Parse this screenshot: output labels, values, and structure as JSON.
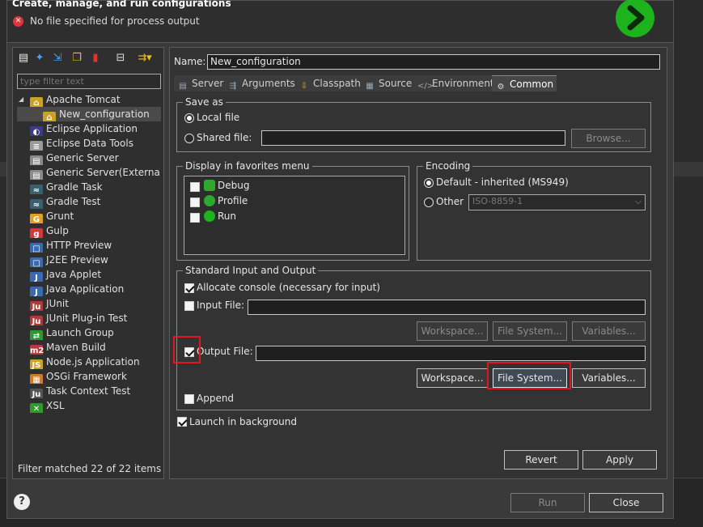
{
  "dialog": {
    "title": "Create, manage, and run configurations",
    "error_message": "No file specified for process output"
  },
  "left": {
    "filter_placeholder": "type filter text",
    "tree": [
      {
        "label": "Apache Tomcat",
        "icon": "tomcat-icon",
        "level": 0
      },
      {
        "label": "New_configuration",
        "icon": "tomcat-config-icon",
        "level": 1,
        "selected": true
      },
      {
        "label": "Eclipse Application",
        "icon": "eclipse-icon",
        "level": 0
      },
      {
        "label": "Eclipse Data Tools",
        "icon": "database-icon",
        "level": 0
      },
      {
        "label": "Generic Server",
        "icon": "server-icon",
        "level": 0
      },
      {
        "label": "Generic Server(External La",
        "icon": "server-icon",
        "level": 0
      },
      {
        "label": "Gradle Task",
        "icon": "gradle-icon",
        "level": 0
      },
      {
        "label": "Gradle Test",
        "icon": "gradle-icon",
        "level": 0
      },
      {
        "label": "Grunt",
        "icon": "grunt-icon",
        "level": 0
      },
      {
        "label": "Gulp",
        "icon": "gulp-icon",
        "level": 0
      },
      {
        "label": "HTTP Preview",
        "icon": "preview-icon",
        "level": 0
      },
      {
        "label": "J2EE Preview",
        "icon": "preview-icon",
        "level": 0
      },
      {
        "label": "Java Applet",
        "icon": "java-icon",
        "level": 0
      },
      {
        "label": "Java Application",
        "icon": "java-icon",
        "level": 0
      },
      {
        "label": "JUnit",
        "icon": "junit-icon",
        "level": 0
      },
      {
        "label": "JUnit Plug-in Test",
        "icon": "junit-icon",
        "level": 0
      },
      {
        "label": "Launch Group",
        "icon": "launch-group-icon",
        "level": 0
      },
      {
        "label": "Maven Build",
        "icon": "maven-icon",
        "level": 0
      },
      {
        "label": "Node.js Application",
        "icon": "nodejs-icon",
        "level": 0
      },
      {
        "label": "OSGi Framework",
        "icon": "osgi-icon",
        "level": 0
      },
      {
        "label": "Task Context Test",
        "icon": "task-icon",
        "level": 0
      },
      {
        "label": "XSL",
        "icon": "xsl-icon",
        "level": 0
      }
    ],
    "status": "Filter matched 22 of 22 items"
  },
  "right": {
    "name_label": "Name:",
    "name_value": "New_configuration",
    "tabs": [
      {
        "label": "Server",
        "icon": "server-icon"
      },
      {
        "label": "Arguments",
        "icon": "arguments-icon"
      },
      {
        "label": "Classpath",
        "icon": "classpath-icon"
      },
      {
        "label": "Source",
        "icon": "source-icon"
      },
      {
        "label": "Environment",
        "icon": "environment-icon"
      },
      {
        "label": "Common",
        "icon": "common-icon",
        "active": true
      }
    ],
    "save_as": {
      "title": "Save as",
      "local_file": "Local file",
      "shared_file": "Shared file:",
      "browse": "Browse..."
    },
    "favorites": {
      "title": "Display in favorites menu",
      "items": [
        "Debug",
        "Profile",
        "Run"
      ]
    },
    "encoding": {
      "title": "Encoding",
      "default": "Default - inherited (MS949)",
      "other": "Other",
      "other_value": "ISO-8859-1"
    },
    "stdio": {
      "title": "Standard Input and Output",
      "allocate_console": "Allocate console (necessary for input)",
      "input_file": "Input File:",
      "output_file": "Output File:",
      "workspace": "Workspace...",
      "file_system": "File System...",
      "variables": "Variables...",
      "append": "Append"
    },
    "launch_bg": "Launch in background",
    "revert": "Revert",
    "apply": "Apply"
  },
  "footer": {
    "run": "Run",
    "close": "Close"
  }
}
